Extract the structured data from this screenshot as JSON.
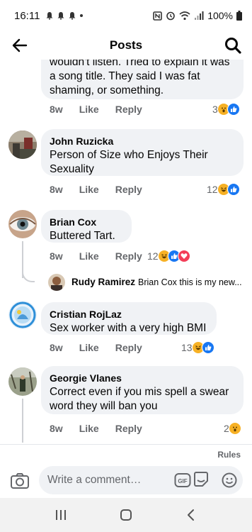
{
  "status": {
    "time": "16:11",
    "battery": "100%"
  },
  "header": {
    "title": "Posts"
  },
  "comments": [
    {
      "name": "",
      "text_line1": "wouldn't listen. Tried to explain it was",
      "text_line2": "a song title. They said I was fat",
      "text_line3": "shaming, or something.",
      "time": "8w",
      "like": "Like",
      "reply": "Reply",
      "reactions": "3"
    },
    {
      "name": "John Ruzicka",
      "text_line1": "Person of Size who Enjoys Their",
      "text_line2": "Sexuality",
      "time": "8w",
      "like": "Like",
      "reply": "Reply",
      "reactions": "12"
    },
    {
      "name": "Brian Cox",
      "text_line1": "Buttered Tart.",
      "time": "8w",
      "like": "Like",
      "reply": "Reply",
      "reactions": "12"
    },
    {
      "name": "Cristian RojLaz",
      "text_line1": "Sex worker with a very high BMI",
      "time": "8w",
      "like": "Like",
      "reply": "Reply",
      "reactions": "13"
    },
    {
      "name": "Georgie Vlanes",
      "text_line1": "Correct even if you mis spell a swear",
      "text_line2": "word they will ban you",
      "time": "8w",
      "like": "Like",
      "reply": "Reply",
      "reactions": "2"
    }
  ],
  "reply_preview": {
    "name": "Rudy Ramirez",
    "text": "Brian Cox this is my new..."
  },
  "footer": {
    "rules": "Rules",
    "placeholder": "Write a comment…"
  },
  "colors": {
    "accent": "#1877f2",
    "bubble": "#f0f2f5",
    "muted": "#65676b",
    "haha": "#f7b125",
    "love": "#f33e58"
  }
}
